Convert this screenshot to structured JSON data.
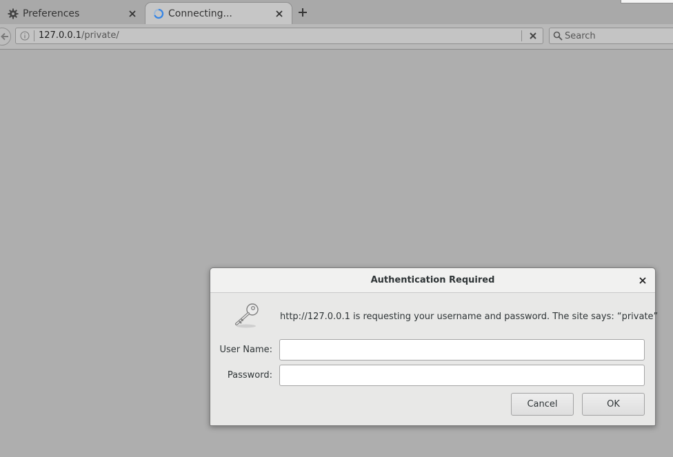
{
  "tabs": [
    {
      "label": "Preferences",
      "icon": "gear-icon"
    },
    {
      "label": "Connecting...",
      "icon": "loading-spinner-icon"
    }
  ],
  "navbar": {
    "url_host": "127.0.0.1",
    "url_path": "/private/",
    "search_placeholder": "Search"
  },
  "dialog": {
    "title": "Authentication Required",
    "message": "http://127.0.0.1 is requesting your username and password. The site says: “private”",
    "username_label": "User Name:",
    "password_label": "Password:",
    "username_value": "",
    "password_value": "",
    "cancel_label": "Cancel",
    "ok_label": "OK"
  },
  "colors": {
    "page_background": "#aeaeae",
    "dialog_background": "#e8e8e7",
    "spinner_accent": "#3584e4"
  }
}
